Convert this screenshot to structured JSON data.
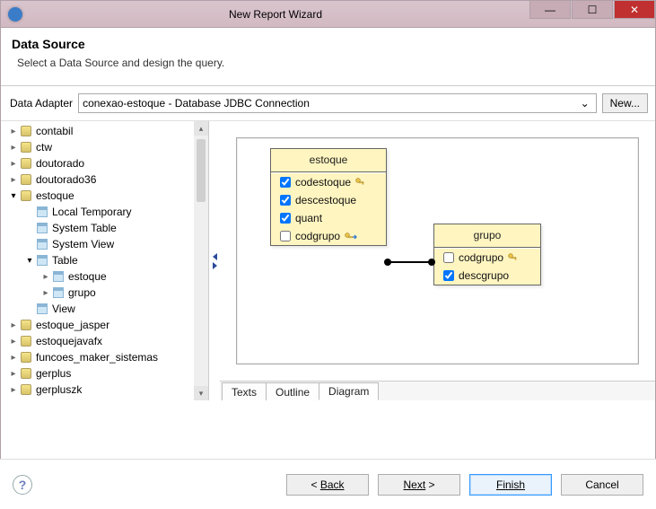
{
  "window": {
    "title": "New Report Wizard"
  },
  "header": {
    "title": "Data Source",
    "subtitle": "Select a Data Source and design the query."
  },
  "adapter": {
    "label": "Data Adapter",
    "value": "conexao-estoque - Database JDBC Connection",
    "new_label": "New..."
  },
  "tree": {
    "items": [
      {
        "label": "contabil",
        "type": "db",
        "indent": 0,
        "arrow": "closed"
      },
      {
        "label": "ctw",
        "type": "db",
        "indent": 0,
        "arrow": "closed"
      },
      {
        "label": "doutorado",
        "type": "db",
        "indent": 0,
        "arrow": "closed"
      },
      {
        "label": "doutorado36",
        "type": "db",
        "indent": 0,
        "arrow": "closed"
      },
      {
        "label": "estoque",
        "type": "db",
        "indent": 0,
        "arrow": "open"
      },
      {
        "label": "Local Temporary",
        "type": "tbl",
        "indent": 1,
        "arrow": "none"
      },
      {
        "label": "System Table",
        "type": "tbl",
        "indent": 1,
        "arrow": "none"
      },
      {
        "label": "System View",
        "type": "tbl",
        "indent": 1,
        "arrow": "none"
      },
      {
        "label": "Table",
        "type": "tbl",
        "indent": 1,
        "arrow": "open"
      },
      {
        "label": "estoque",
        "type": "tbl",
        "indent": 2,
        "arrow": "closed"
      },
      {
        "label": "grupo",
        "type": "tbl",
        "indent": 2,
        "arrow": "closed"
      },
      {
        "label": "View",
        "type": "tbl",
        "indent": 1,
        "arrow": "none"
      },
      {
        "label": "estoque_jasper",
        "type": "db",
        "indent": 0,
        "arrow": "closed"
      },
      {
        "label": "estoquejavafx",
        "type": "db",
        "indent": 0,
        "arrow": "closed"
      },
      {
        "label": "funcoes_maker_sistemas",
        "type": "db",
        "indent": 0,
        "arrow": "closed"
      },
      {
        "label": "gerplus",
        "type": "db",
        "indent": 0,
        "arrow": "closed"
      },
      {
        "label": "gerpluszk",
        "type": "db",
        "indent": 0,
        "arrow": "closed"
      }
    ]
  },
  "diagram": {
    "entities": [
      {
        "name": "estoque",
        "fields": [
          {
            "name": "codestoque",
            "checked": true,
            "key": "pk"
          },
          {
            "name": "descestoque",
            "checked": true,
            "key": ""
          },
          {
            "name": "quant",
            "checked": true,
            "key": ""
          },
          {
            "name": "codgrupo",
            "checked": false,
            "key": "fk"
          }
        ]
      },
      {
        "name": "grupo",
        "fields": [
          {
            "name": "codgrupo",
            "checked": false,
            "key": "pk"
          },
          {
            "name": "descgrupo",
            "checked": true,
            "key": ""
          }
        ]
      }
    ]
  },
  "tabs": {
    "items": [
      "Texts",
      "Outline",
      "Diagram"
    ],
    "active": 2
  },
  "footer": {
    "back": "Back",
    "next": "Next",
    "finish": "Finish",
    "cancel": "Cancel"
  }
}
